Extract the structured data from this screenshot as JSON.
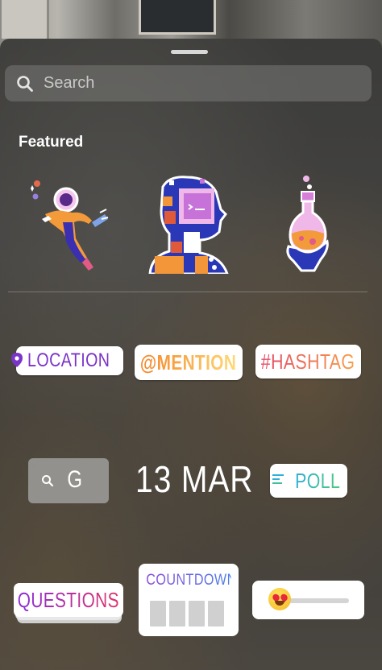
{
  "search": {
    "placeholder": "Search"
  },
  "featured": {
    "title": "Featured",
    "items": [
      {
        "name": "astronaut-sticker"
      },
      {
        "name": "robot-profile-sticker"
      },
      {
        "name": "potion-flask-sticker"
      }
    ]
  },
  "stickers": {
    "location": "LOCATION",
    "mention": "@MENTION",
    "hashtag": "#HASHTAG",
    "gif": "G",
    "date": "13 MAR",
    "poll": "POLL",
    "questions": "QUESTIONS",
    "countdown": "COUNTDOWN"
  },
  "colors": {
    "location": "#7b34c8",
    "mention_start": "#f58529",
    "hashtag_start": "#e34a67",
    "poll_start": "#2db0d8",
    "questions_start": "#8a2fd6",
    "countdown_start": "#8a4ce0"
  },
  "icons": {
    "search": "search-icon",
    "location": "location-pin-icon",
    "poll": "poll-lines-icon",
    "emoji": "heart-eyes-emoji-icon"
  }
}
